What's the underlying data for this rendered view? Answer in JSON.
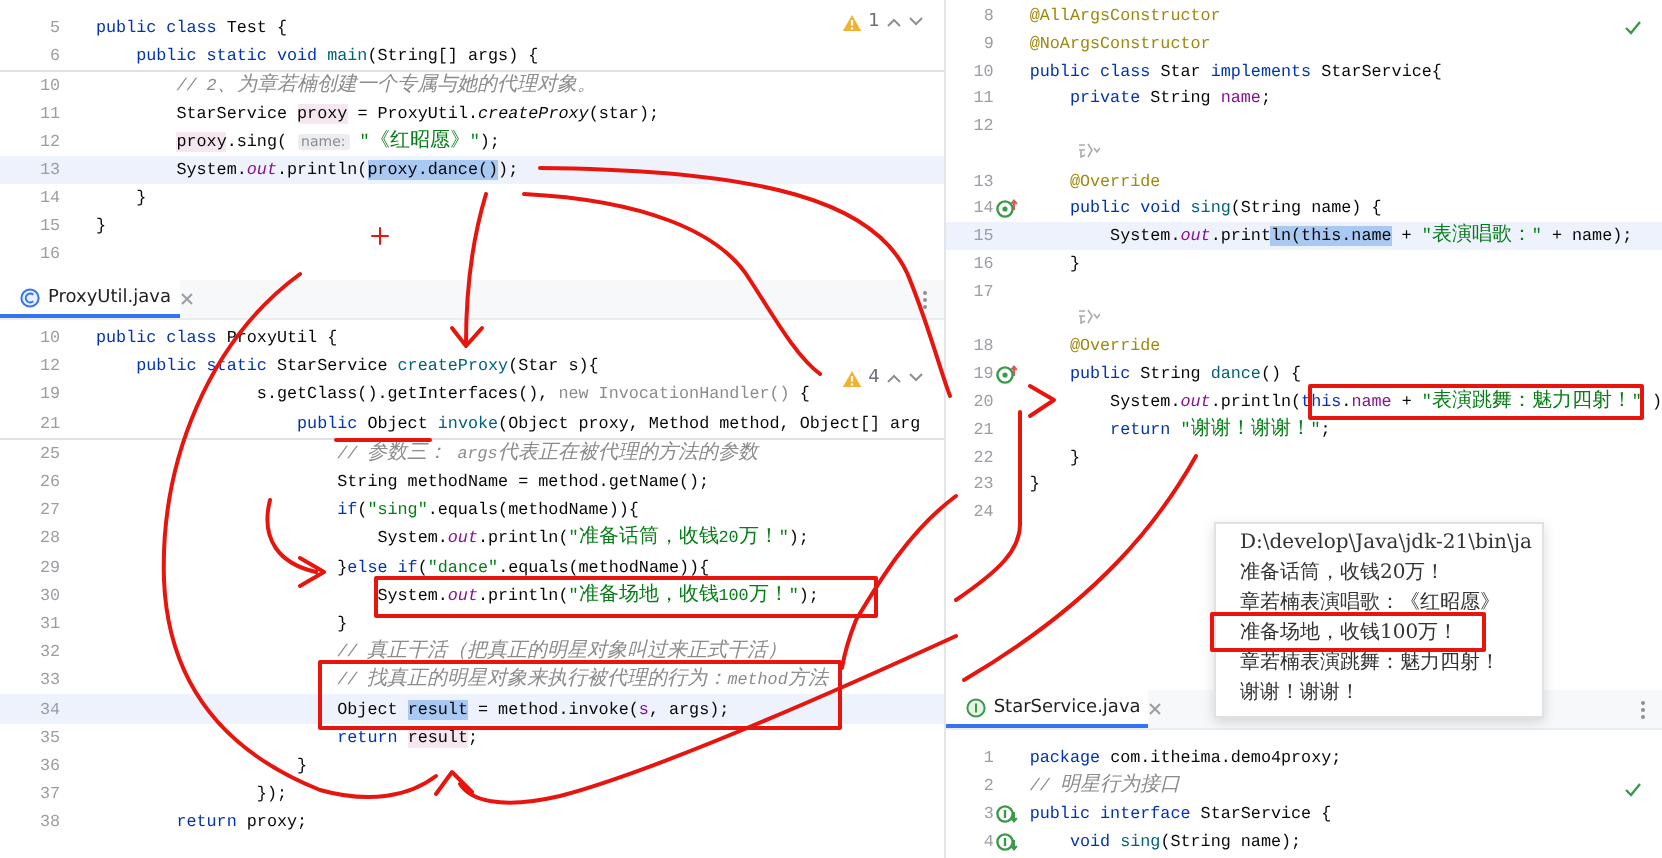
{
  "panes": [
    {
      "inspection": {
        "kind": "warning",
        "count": "1"
      },
      "sticky_lines": [
        {
          "num": "5",
          "kind": "code",
          "current": false,
          "code": [
            {
              "kind": "keyword",
              "text": "public class "
            },
            {
              "kind": "plain",
              "text": "Test {"
            }
          ]
        },
        {
          "num": "6",
          "kind": "code",
          "current": false,
          "code": [
            {
              "kind": "keyword",
              "text": "    public static void "
            },
            {
              "kind": "method",
              "text": "main"
            },
            {
              "kind": "plain",
              "text": "(String[] args) {"
            }
          ]
        }
      ],
      "lines": [
        {
          "num": "10",
          "kind": "code",
          "current": false,
          "code": [
            {
              "kind": "comment",
              "text": "        // 2、为章若楠创建一个专属与她的代理对象。"
            }
          ]
        },
        {
          "num": "11",
          "kind": "code",
          "current": false,
          "code": [
            {
              "kind": "plain",
              "text": "        StarService "
            },
            {
              "kind": "var",
              "text": "proxy"
            },
            {
              "kind": "plain",
              "text": " = ProxyUtil."
            },
            {
              "kind": "italic",
              "text": "createProxy"
            },
            {
              "kind": "plain",
              "text": "(star);"
            }
          ]
        },
        {
          "num": "12",
          "kind": "code",
          "current": false,
          "code": [
            {
              "kind": "var",
              "text": "        proxy"
            },
            {
              "kind": "plain",
              "text": ".sing( "
            },
            {
              "kind": "hint",
              "text": "name:"
            },
            {
              "kind": "string",
              "text": " \"《红昭愿》\""
            },
            {
              "kind": "plain",
              "text": ");"
            }
          ]
        },
        {
          "num": "13",
          "kind": "code",
          "current": true,
          "code": [
            {
              "kind": "plain",
              "text": "        System."
            },
            {
              "kind": "field",
              "text": "out"
            },
            {
              "kind": "plain",
              "text": ".println("
            },
            {
              "kind": "selection",
              "text": "proxy.dance()"
            },
            {
              "kind": "plain",
              "text": ");"
            }
          ]
        },
        {
          "num": "14",
          "kind": "code",
          "current": false,
          "code": [
            {
              "kind": "plain",
              "text": "    }"
            }
          ]
        },
        {
          "num": "15",
          "kind": "code",
          "current": false,
          "code": [
            {
              "kind": "plain",
              "text": "}"
            }
          ]
        },
        {
          "num": "16",
          "kind": "code",
          "current": false
        }
      ]
    },
    {
      "tabs": [
        {
          "label": "ProxyUtil.java",
          "kind": "class",
          "selected": true
        }
      ],
      "inspection": {
        "kind": "warning",
        "count": "4"
      },
      "sticky_lines": [
        {
          "num": "10",
          "kind": "code",
          "current": false,
          "code": [
            {
              "kind": "keyword",
              "text": "public class "
            },
            {
              "kind": "plain",
              "text": "ProxyUtil {"
            }
          ]
        },
        {
          "num": "12",
          "kind": "code",
          "current": false,
          "code": [
            {
              "kind": "keyword",
              "text": "    public static "
            },
            {
              "kind": "plain",
              "text": "StarService "
            },
            {
              "kind": "method",
              "text": "createProxy"
            },
            {
              "kind": "plain",
              "text": "(Star s){"
            }
          ]
        },
        {
          "num": "19",
          "kind": "code",
          "current": false,
          "code": [
            {
              "kind": "plain",
              "text": "                s.getClass().getInterfaces(), "
            },
            {
              "kind": "dim",
              "text": "new InvocationHandler()"
            },
            {
              "kind": "plain",
              "text": " {"
            }
          ]
        },
        {
          "num": "21",
          "kind": "code",
          "current": false,
          "code": [
            {
              "kind": "keyword",
              "text": "                    public "
            },
            {
              "kind": "plain",
              "text": "Object "
            },
            {
              "kind": "method",
              "text": "invoke"
            },
            {
              "kind": "plain",
              "text": "(Object proxy, Method method, Object[] arg"
            }
          ]
        }
      ],
      "lines": [
        {
          "num": "25",
          "kind": "code",
          "current": false,
          "code": [
            {
              "kind": "comment",
              "text": "                        // 参数三： args代表正在被代理的方法的参数"
            }
          ]
        },
        {
          "num": "26",
          "kind": "code",
          "current": false,
          "code": [
            {
              "kind": "plain",
              "text": "                        String methodName = method.getName();"
            }
          ]
        },
        {
          "num": "27",
          "kind": "code",
          "current": false,
          "code": [
            {
              "kind": "keyword",
              "text": "                        if"
            },
            {
              "kind": "plain",
              "text": "("
            },
            {
              "kind": "string",
              "text": "\"sing\""
            },
            {
              "kind": "plain",
              "text": ".equals(methodName)){"
            }
          ]
        },
        {
          "num": "28",
          "kind": "code",
          "current": false,
          "code": [
            {
              "kind": "plain",
              "text": "                            System."
            },
            {
              "kind": "field",
              "text": "out"
            },
            {
              "kind": "plain",
              "text": ".println("
            },
            {
              "kind": "string",
              "text": "\"准备话筒，收钱20万！\""
            },
            {
              "kind": "plain",
              "text": ");"
            }
          ]
        },
        {
          "num": "29",
          "kind": "code",
          "current": false,
          "code": [
            {
              "kind": "plain",
              "text": "                        }"
            },
            {
              "kind": "keyword",
              "text": "else if"
            },
            {
              "kind": "plain",
              "text": "("
            },
            {
              "kind": "string",
              "text": "\"dance\""
            },
            {
              "kind": "plain",
              "text": ".equals(methodName)){"
            }
          ]
        },
        {
          "num": "30",
          "kind": "code",
          "current": false,
          "code": [
            {
              "kind": "plain",
              "text": "                            System."
            },
            {
              "kind": "field",
              "text": "out"
            },
            {
              "kind": "plain",
              "text": ".println("
            },
            {
              "kind": "string",
              "text": "\"准备场地，收钱100万！\""
            },
            {
              "kind": "plain",
              "text": ");"
            }
          ]
        },
        {
          "num": "31",
          "kind": "code",
          "current": false,
          "code": [
            {
              "kind": "plain",
              "text": "                        }"
            }
          ]
        },
        {
          "num": "32",
          "kind": "code",
          "current": false,
          "code": [
            {
              "kind": "comment",
              "text": "                        // 真正干活（把真正的明星对象叫过来正式干活）"
            }
          ]
        },
        {
          "num": "33",
          "kind": "code",
          "current": false,
          "code": [
            {
              "kind": "comment",
              "text": "                        // 找真正的明星对象来执行被代理的行为：method方法"
            }
          ]
        },
        {
          "num": "34",
          "kind": "code",
          "current": true,
          "code": [
            {
              "kind": "plain",
              "text": "                        Object "
            },
            {
              "kind": "selection",
              "text": "result"
            },
            {
              "kind": "plain",
              "text": " = method.invoke("
            },
            {
              "kind": "member",
              "text": "s"
            },
            {
              "kind": "plain",
              "text": ", args);"
            }
          ]
        },
        {
          "num": "35",
          "kind": "code",
          "current": false,
          "code": [
            {
              "kind": "keyword",
              "text": "                        return "
            },
            {
              "kind": "var",
              "text": "result"
            },
            {
              "kind": "plain",
              "text": ";"
            }
          ]
        },
        {
          "num": "36",
          "kind": "code",
          "current": false,
          "code": [
            {
              "kind": "plain",
              "text": "                    }"
            }
          ]
        },
        {
          "num": "37",
          "kind": "code",
          "current": false,
          "code": [
            {
              "kind": "plain",
              "text": "                });"
            }
          ]
        },
        {
          "num": "38",
          "kind": "code",
          "current": false,
          "code": [
            {
              "kind": "keyword",
              "text": "        return "
            },
            {
              "kind": "plain",
              "text": "proxy;"
            }
          ]
        }
      ]
    },
    {
      "inspection": {
        "kind": "ok"
      },
      "lines": [
        {
          "num": "8",
          "kind": "code",
          "current": false,
          "code": [
            {
              "kind": "annotation",
              "text": "@AllArgsConstructor"
            }
          ]
        },
        {
          "num": "9",
          "kind": "code",
          "current": false,
          "code": [
            {
              "kind": "annotation",
              "text": "@NoArgsConstructor"
            }
          ]
        },
        {
          "num": "10",
          "kind": "code",
          "current": false,
          "code": [
            {
              "kind": "keyword",
              "text": "public class "
            },
            {
              "kind": "plain",
              "text": "Star "
            },
            {
              "kind": "keyword",
              "text": "implements "
            },
            {
              "kind": "plain",
              "text": "StarService{"
            }
          ]
        },
        {
          "num": "11",
          "kind": "code",
          "current": false,
          "code": [
            {
              "kind": "keyword",
              "text": "    private "
            },
            {
              "kind": "plain",
              "text": "String "
            },
            {
              "kind": "member",
              "text": "name"
            },
            {
              "kind": "plain",
              "text": ";"
            }
          ]
        },
        {
          "num": "12",
          "kind": "code",
          "current": false
        },
        {
          "kind": "hint",
          "current": false
        },
        {
          "num": "13",
          "kind": "code",
          "current": false,
          "code": [
            {
              "kind": "annotation",
              "text": "    @Override"
            }
          ]
        },
        {
          "num": "14",
          "kind": "code",
          "current": false,
          "gutter": {
            "kind": "override"
          },
          "code": [
            {
              "kind": "keyword",
              "text": "    public void "
            },
            {
              "kind": "method",
              "text": "sing"
            },
            {
              "kind": "plain",
              "text": "(String name) {"
            }
          ]
        },
        {
          "num": "15",
          "kind": "code",
          "current": true,
          "code": [
            {
              "kind": "plain",
              "text": "        System."
            },
            {
              "kind": "field",
              "text": "out"
            },
            {
              "kind": "plain",
              "text": ".print"
            },
            {
              "kind": "selection",
              "text": "ln(this.name"
            },
            {
              "kind": "plain",
              "text": " + "
            },
            {
              "kind": "string",
              "text": "\"表演唱歌：\""
            },
            {
              "kind": "plain",
              "text": " + name);"
            }
          ]
        },
        {
          "num": "16",
          "kind": "code",
          "current": false,
          "code": [
            {
              "kind": "plain",
              "text": "    }"
            }
          ]
        },
        {
          "num": "17",
          "kind": "code",
          "current": false
        },
        {
          "kind": "hint",
          "current": false
        },
        {
          "num": "18",
          "kind": "code",
          "current": false,
          "code": [
            {
              "kind": "annotation",
              "text": "    @Override"
            }
          ]
        },
        {
          "num": "19",
          "kind": "code",
          "current": false,
          "gutter": {
            "kind": "override"
          },
          "code": [
            {
              "kind": "keyword",
              "text": "    public "
            },
            {
              "kind": "plain",
              "text": "String "
            },
            {
              "kind": "method",
              "text": "dance"
            },
            {
              "kind": "plain",
              "text": "() {"
            }
          ]
        },
        {
          "num": "20",
          "kind": "code",
          "current": false,
          "code": [
            {
              "kind": "plain",
              "text": "        System."
            },
            {
              "kind": "field",
              "text": "out"
            },
            {
              "kind": "plain",
              "text": ".println("
            },
            {
              "kind": "keyword",
              "text": "this"
            },
            {
              "kind": "plain",
              "text": "."
            },
            {
              "kind": "member",
              "text": "name"
            },
            {
              "kind": "plain",
              "text": " + "
            },
            {
              "kind": "string",
              "text": "\"表演跳舞：魅力四射！\""
            },
            {
              "kind": "plain",
              "text": " )"
            }
          ]
        },
        {
          "num": "21",
          "kind": "code",
          "current": false,
          "code": [
            {
              "kind": "keyword",
              "text": "        return "
            },
            {
              "kind": "string",
              "text": "\"谢谢！谢谢！\""
            },
            {
              "kind": "plain",
              "text": ";"
            }
          ]
        },
        {
          "num": "22",
          "kind": "code",
          "current": false,
          "code": [
            {
              "kind": "plain",
              "text": "    }"
            }
          ]
        },
        {
          "num": "23",
          "kind": "code",
          "current": false,
          "code": [
            {
              "kind": "plain",
              "text": "}"
            }
          ]
        },
        {
          "num": "24",
          "kind": "code",
          "current": false
        }
      ]
    },
    {
      "tabs": [
        {
          "label": "StarService.java",
          "kind": "interface",
          "selected": true
        }
      ],
      "inspection": {
        "kind": "ok"
      },
      "lines": [
        {
          "num": "1",
          "kind": "code",
          "current": false,
          "code": [
            {
              "kind": "keyword",
              "text": "package "
            },
            {
              "kind": "plain",
              "text": "com.itheima.demo4proxy;"
            }
          ]
        },
        {
          "num": "2",
          "kind": "code",
          "current": false,
          "code": [
            {
              "kind": "comment",
              "text": "// 明星行为接口"
            }
          ]
        },
        {
          "num": "3",
          "kind": "code",
          "current": false,
          "gutter": {
            "kind": "implemented"
          },
          "code": [
            {
              "kind": "keyword",
              "text": "public interface "
            },
            {
              "kind": "plain",
              "text": "StarService {"
            }
          ]
        },
        {
          "num": "4",
          "kind": "code",
          "current": false,
          "gutter": {
            "kind": "implemented"
          },
          "code": [
            {
              "kind": "keyword",
              "text": "    void "
            },
            {
              "kind": "method",
              "text": "sing"
            },
            {
              "kind": "plain",
              "text": "(String name);"
            }
          ]
        }
      ]
    }
  ],
  "console": {
    "lines": [
      "D:\\develop\\Java\\jdk-21\\bin\\ja",
      "准备话筒，收钱20万！",
      "章若楠表演唱歌：《红昭愿》",
      "准备场地，收钱100万！",
      "章若楠表演跳舞：魅力四射！",
      "谢谢！谢谢！"
    ]
  }
}
